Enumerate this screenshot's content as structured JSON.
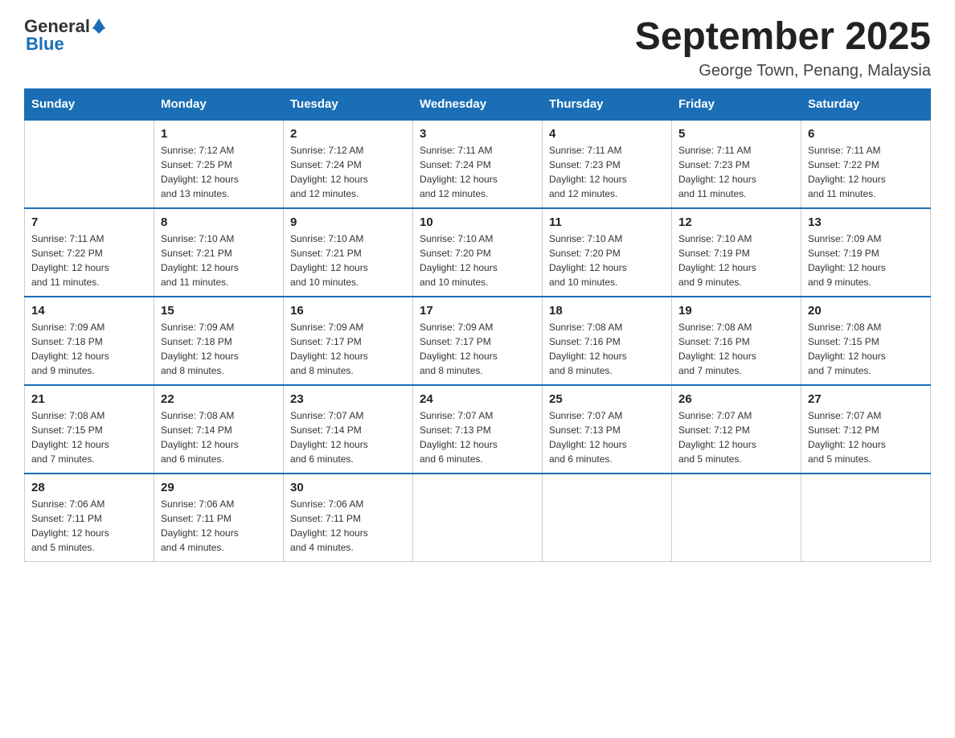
{
  "logo": {
    "text_general": "General",
    "text_blue": "Blue"
  },
  "header": {
    "title": "September 2025",
    "subtitle": "George Town, Penang, Malaysia"
  },
  "days_of_week": [
    "Sunday",
    "Monday",
    "Tuesday",
    "Wednesday",
    "Thursday",
    "Friday",
    "Saturday"
  ],
  "weeks": [
    [
      {
        "day": "",
        "info": ""
      },
      {
        "day": "1",
        "info": "Sunrise: 7:12 AM\nSunset: 7:25 PM\nDaylight: 12 hours\nand 13 minutes."
      },
      {
        "day": "2",
        "info": "Sunrise: 7:12 AM\nSunset: 7:24 PM\nDaylight: 12 hours\nand 12 minutes."
      },
      {
        "day": "3",
        "info": "Sunrise: 7:11 AM\nSunset: 7:24 PM\nDaylight: 12 hours\nand 12 minutes."
      },
      {
        "day": "4",
        "info": "Sunrise: 7:11 AM\nSunset: 7:23 PM\nDaylight: 12 hours\nand 12 minutes."
      },
      {
        "day": "5",
        "info": "Sunrise: 7:11 AM\nSunset: 7:23 PM\nDaylight: 12 hours\nand 11 minutes."
      },
      {
        "day": "6",
        "info": "Sunrise: 7:11 AM\nSunset: 7:22 PM\nDaylight: 12 hours\nand 11 minutes."
      }
    ],
    [
      {
        "day": "7",
        "info": "Sunrise: 7:11 AM\nSunset: 7:22 PM\nDaylight: 12 hours\nand 11 minutes."
      },
      {
        "day": "8",
        "info": "Sunrise: 7:10 AM\nSunset: 7:21 PM\nDaylight: 12 hours\nand 11 minutes."
      },
      {
        "day": "9",
        "info": "Sunrise: 7:10 AM\nSunset: 7:21 PM\nDaylight: 12 hours\nand 10 minutes."
      },
      {
        "day": "10",
        "info": "Sunrise: 7:10 AM\nSunset: 7:20 PM\nDaylight: 12 hours\nand 10 minutes."
      },
      {
        "day": "11",
        "info": "Sunrise: 7:10 AM\nSunset: 7:20 PM\nDaylight: 12 hours\nand 10 minutes."
      },
      {
        "day": "12",
        "info": "Sunrise: 7:10 AM\nSunset: 7:19 PM\nDaylight: 12 hours\nand 9 minutes."
      },
      {
        "day": "13",
        "info": "Sunrise: 7:09 AM\nSunset: 7:19 PM\nDaylight: 12 hours\nand 9 minutes."
      }
    ],
    [
      {
        "day": "14",
        "info": "Sunrise: 7:09 AM\nSunset: 7:18 PM\nDaylight: 12 hours\nand 9 minutes."
      },
      {
        "day": "15",
        "info": "Sunrise: 7:09 AM\nSunset: 7:18 PM\nDaylight: 12 hours\nand 8 minutes."
      },
      {
        "day": "16",
        "info": "Sunrise: 7:09 AM\nSunset: 7:17 PM\nDaylight: 12 hours\nand 8 minutes."
      },
      {
        "day": "17",
        "info": "Sunrise: 7:09 AM\nSunset: 7:17 PM\nDaylight: 12 hours\nand 8 minutes."
      },
      {
        "day": "18",
        "info": "Sunrise: 7:08 AM\nSunset: 7:16 PM\nDaylight: 12 hours\nand 8 minutes."
      },
      {
        "day": "19",
        "info": "Sunrise: 7:08 AM\nSunset: 7:16 PM\nDaylight: 12 hours\nand 7 minutes."
      },
      {
        "day": "20",
        "info": "Sunrise: 7:08 AM\nSunset: 7:15 PM\nDaylight: 12 hours\nand 7 minutes."
      }
    ],
    [
      {
        "day": "21",
        "info": "Sunrise: 7:08 AM\nSunset: 7:15 PM\nDaylight: 12 hours\nand 7 minutes."
      },
      {
        "day": "22",
        "info": "Sunrise: 7:08 AM\nSunset: 7:14 PM\nDaylight: 12 hours\nand 6 minutes."
      },
      {
        "day": "23",
        "info": "Sunrise: 7:07 AM\nSunset: 7:14 PM\nDaylight: 12 hours\nand 6 minutes."
      },
      {
        "day": "24",
        "info": "Sunrise: 7:07 AM\nSunset: 7:13 PM\nDaylight: 12 hours\nand 6 minutes."
      },
      {
        "day": "25",
        "info": "Sunrise: 7:07 AM\nSunset: 7:13 PM\nDaylight: 12 hours\nand 6 minutes."
      },
      {
        "day": "26",
        "info": "Sunrise: 7:07 AM\nSunset: 7:12 PM\nDaylight: 12 hours\nand 5 minutes."
      },
      {
        "day": "27",
        "info": "Sunrise: 7:07 AM\nSunset: 7:12 PM\nDaylight: 12 hours\nand 5 minutes."
      }
    ],
    [
      {
        "day": "28",
        "info": "Sunrise: 7:06 AM\nSunset: 7:11 PM\nDaylight: 12 hours\nand 5 minutes."
      },
      {
        "day": "29",
        "info": "Sunrise: 7:06 AM\nSunset: 7:11 PM\nDaylight: 12 hours\nand 4 minutes."
      },
      {
        "day": "30",
        "info": "Sunrise: 7:06 AM\nSunset: 7:11 PM\nDaylight: 12 hours\nand 4 minutes."
      },
      {
        "day": "",
        "info": ""
      },
      {
        "day": "",
        "info": ""
      },
      {
        "day": "",
        "info": ""
      },
      {
        "day": "",
        "info": ""
      }
    ]
  ]
}
